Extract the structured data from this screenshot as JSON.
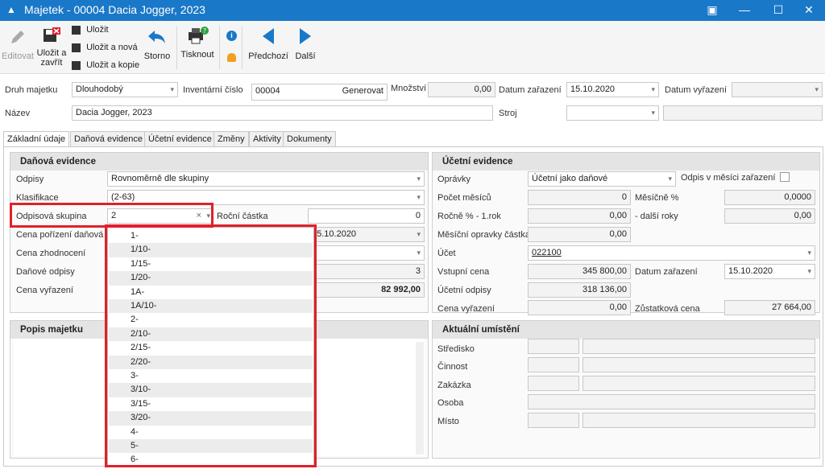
{
  "window": {
    "title": "Majetek - 00004 Dacia Jogger, 2023",
    "app_icon": "app-triangle-icon",
    "buttons": [
      "restore",
      "minimize",
      "maximize",
      "close"
    ]
  },
  "toolbar": {
    "edit_label": "Editovat",
    "save_close_label_1": "Uložit a",
    "save_close_label_2": "zavřít",
    "save_label": "Uložit",
    "save_new_label": "Uložit a nová",
    "save_copy_label": "Uložit a kopie",
    "cancel_label": "Storno",
    "print_label": "Tisknout",
    "prev_label": "Předchozí",
    "next_label": "Další"
  },
  "header": {
    "druh_label": "Druh majetku",
    "druh_value": "Dlouhodobý",
    "inv_label": "Inventární číslo",
    "inv_value": "00004",
    "generate_label": "Generovat",
    "qty_label": "Množství",
    "qty_value": "0,00",
    "date_label": "Datum zařazení",
    "date_value": "15.10.2020",
    "disposal_label": "Datum vyřazení",
    "disposal_value": "",
    "name_label": "Název",
    "name_value": "Dacia Jogger, 2023",
    "machine_label": "Stroj",
    "machine_value": ""
  },
  "tabs": [
    "Základní údaje",
    "Daňová evidence",
    "Účetní evidence",
    "Změny",
    "Aktivity",
    "Dokumenty"
  ],
  "tax": {
    "heading": "Daňová evidence",
    "odpisy_label": "Odpisy",
    "odpisy_value": "Rovnoměrně dle skupiny",
    "klas_label": "Klasifikace",
    "klas_value": "(2-63)",
    "group_label": "Odpisová skupina",
    "group_value": "2",
    "annual_label": "Roční částka",
    "annual_value": "0",
    "price_label": "Cena pořízení daňová",
    "price_date_value": "15.10.2020",
    "appr_label": "Cena zhodnocení",
    "tax_dep_label": "Daňové odpisy",
    "tax_dep_value": "3",
    "disp_label": "Cena vyřazení",
    "disp_value": "82 992,00"
  },
  "dropdown_options": [
    "1-",
    "1/10-",
    "1/15-",
    "1/20-",
    "1A-",
    "1A/10-",
    "2-",
    "2/10-",
    "2/15-",
    "2/20-",
    "3-",
    "3/10-",
    "3/15-",
    "3/20-",
    "4-",
    "5-",
    "6-"
  ],
  "description": {
    "heading": "Popis majetku"
  },
  "accounting": {
    "heading": "Účetní evidence",
    "opravky_label": "Oprávky",
    "opravky_value": "Účetní jako daňové",
    "monthly_start_label": "Odpis v měsíci zařazení",
    "months_label": "Počet měsíců",
    "months_value": "0",
    "monthly_pct_label": "Měsíčně %",
    "monthly_pct_value": "0,0000",
    "yearly_first_label": "Ročně % - 1.rok",
    "yearly_first_value": "0,00",
    "yearly_next_label": "- další roky",
    "yearly_next_value": "0,00",
    "monthly_amount_label": "Měsíční opravky částka",
    "monthly_amount_value": "0,00",
    "account_label": "Účet",
    "account_value": "022100",
    "input_price_label": "Vstupní cena",
    "input_price_value": "345 800,00",
    "date_label": "Datum zařazení",
    "date_value": "15.10.2020",
    "acc_dep_label": "Účetní odpisy",
    "acc_dep_value": "318 136,00",
    "disp_label": "Cena vyřazení",
    "disp_value": "0,00",
    "residual_label": "Zůstatková cena",
    "residual_value": "27 664,00"
  },
  "location": {
    "heading": "Aktuální umístění",
    "labels": [
      "Středisko",
      "Činnost",
      "Zakázka",
      "Osoba",
      "Místo"
    ]
  },
  "colors": {
    "titlebar": "#1a78c8",
    "highlight": "#e0202a",
    "arrow": "#1a78c8"
  }
}
